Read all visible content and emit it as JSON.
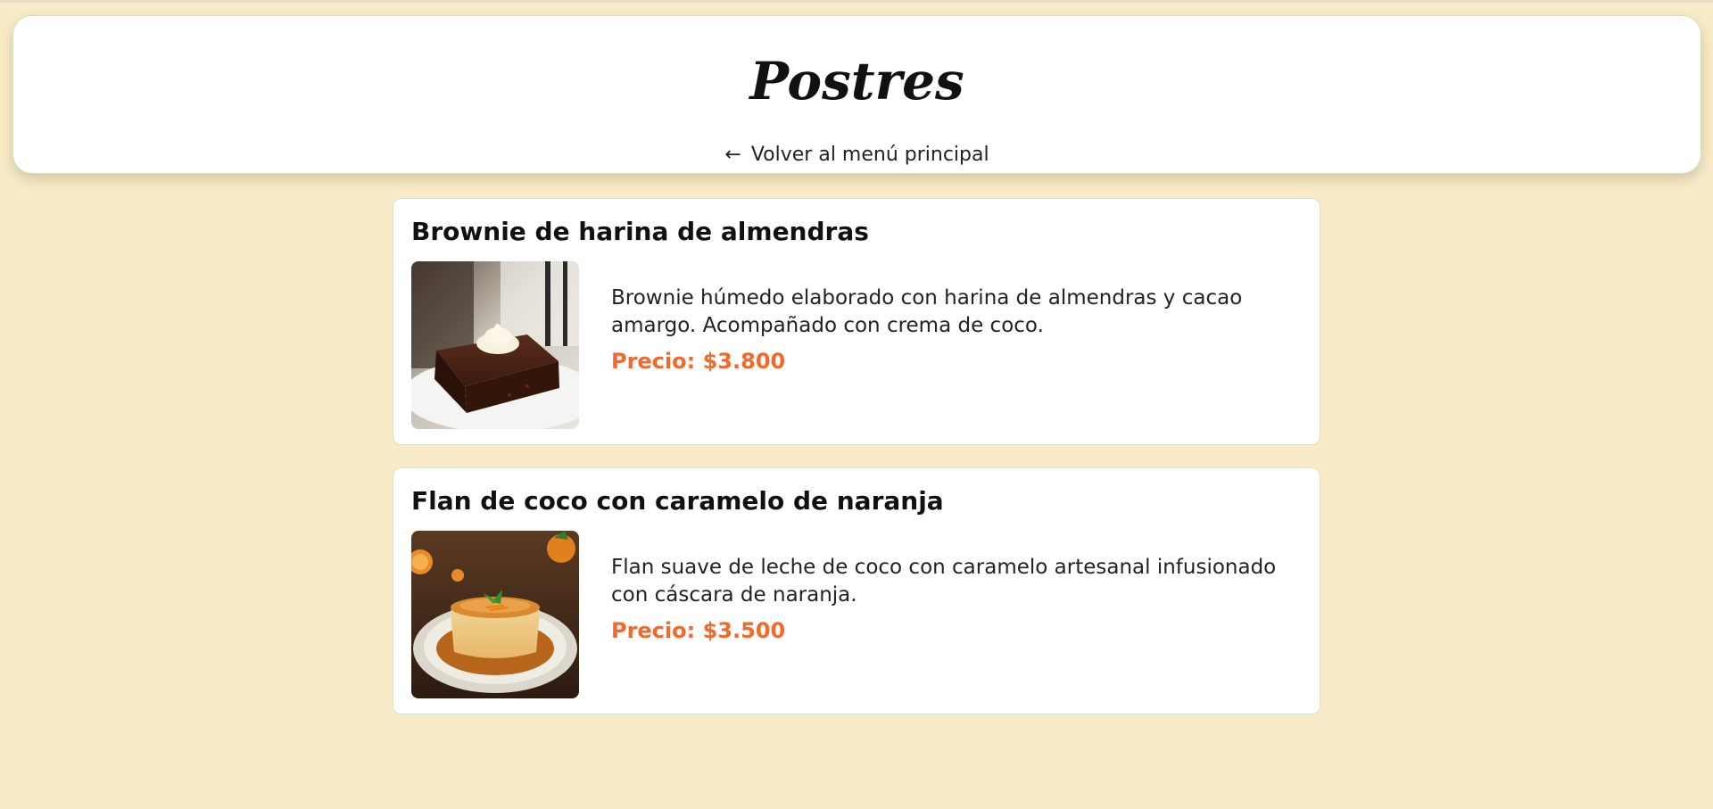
{
  "header": {
    "title": "Postres",
    "back_arrow": "←",
    "back_label": "Volver al menú principal"
  },
  "items": [
    {
      "title": "Brownie de harina de almendras",
      "description": "Brownie húmedo elaborado con harina de almendras y cacao amargo. Acompañado con crema de coco.",
      "price": "Precio: $3.800"
    },
    {
      "title": "Flan de coco con caramelo de naranja",
      "description": "Flan suave de leche de coco con caramelo artesanal infusionado con cáscara de naranja.",
      "price": "Precio: $3.500"
    }
  ],
  "colors": {
    "background": "#f8ebc7",
    "price": "#ef6a2c",
    "card_border": "#d8e2cf"
  }
}
